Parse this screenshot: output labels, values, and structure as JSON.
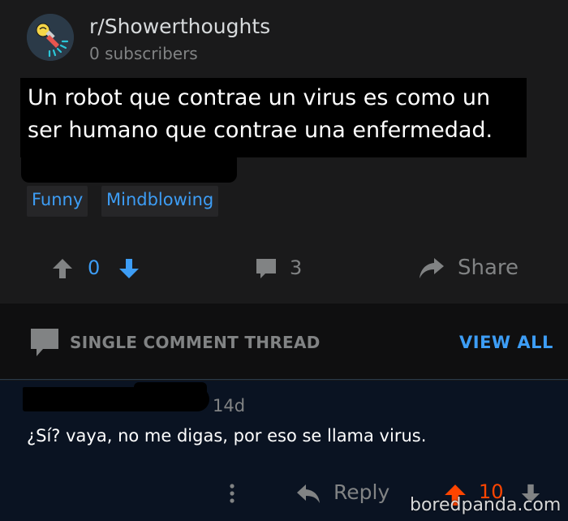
{
  "colors": {
    "background": "#1a1a1b",
    "accent_blue": "#3d9df5",
    "muted_gray": "#818384",
    "upvote_orange": "#ff4500",
    "comment_bg": "#0a1322"
  },
  "subreddit": {
    "icon": "shower-lightbulb-icon",
    "name": "r/Showerthoughts",
    "subscribers": "0 subscribers"
  },
  "post": {
    "title": "Un robot que contrae un virus es como un ser humano que contrae una enfermedad.",
    "flairs": [
      "Funny",
      "Mindblowing"
    ],
    "votes": "0",
    "comments": "3",
    "share_label": "Share"
  },
  "thread": {
    "label": "SINGLE COMMENT THREAD",
    "view_all": "VIEW ALL"
  },
  "comment": {
    "age": "14d",
    "text": "¿Sí? vaya, no me digas, por eso se llama virus.",
    "reply_label": "Reply",
    "score": "10"
  },
  "watermark": "boredpanda.com"
}
